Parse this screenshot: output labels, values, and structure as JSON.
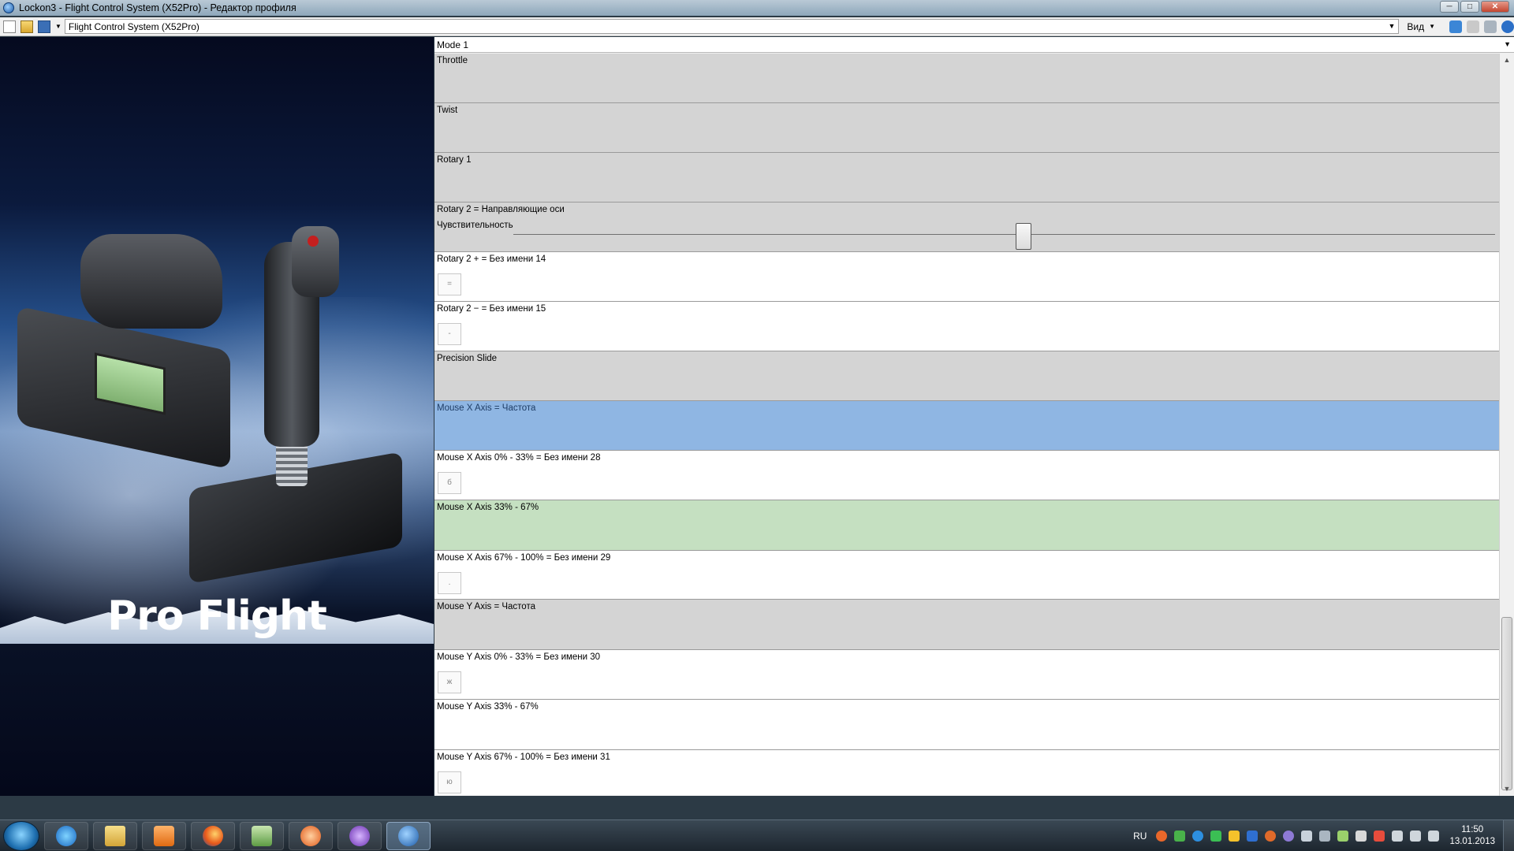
{
  "window": {
    "title": "Lockon3 - Flight Control System (X52Pro) - Редактор профиля",
    "minimize_glyph": "─",
    "maximize_glyph": "□",
    "close_glyph": "✕"
  },
  "toolbar": {
    "profile_value": "Flight Control System (X52Pro)",
    "view_label": "Вид",
    "dropdown_glyph": "▼"
  },
  "left_panel": {
    "brand": "Pro Flight"
  },
  "config": {
    "mode": "Mode 1",
    "rows": [
      {
        "label": "Throttle"
      },
      {
        "label": "Twist"
      },
      {
        "label": "Rotary 1"
      },
      {
        "label": "Rotary 2 = Направляющие оси",
        "sensitivity_label": "Чувствительность",
        "sensitivity_value": 0.52
      },
      {
        "label": "Rotary 2  +  = Без имени 14",
        "key": "="
      },
      {
        "label": "Rotary 2  −  = Без имени 15",
        "key": "-"
      },
      {
        "label": "Precision Slide"
      },
      {
        "label": "Mouse X Axis = Частота"
      },
      {
        "label": "Mouse X Axis 0% - 33% = Без имени 28",
        "key": "б"
      },
      {
        "label": "Mouse X Axis 33% - 67%"
      },
      {
        "label": "Mouse X Axis 67% - 100% = Без имени 29",
        "key": "."
      },
      {
        "label": "Mouse Y Axis = Частота"
      },
      {
        "label": "Mouse Y Axis 0% - 33% = Без имени 30",
        "key": "ж"
      },
      {
        "label": "Mouse Y Axis 33% - 67%"
      },
      {
        "label": "Mouse Y Axis 67% - 100% = Без имени 31",
        "key": "ю"
      }
    ]
  },
  "taskbar": {
    "language": "RU",
    "time": "11:50",
    "date": "13.01.2013"
  },
  "colors": {
    "row_gray": "#d4d4d4",
    "row_white": "#ffffff",
    "row_selected_blue": "#8fb6e3",
    "row_green": "#c5e0c1"
  },
  "icons": [
    "new-file-icon",
    "open-folder-icon",
    "save-icon",
    "ie-icon",
    "explorer-icon",
    "media-player-icon",
    "firefox-icon",
    "green-app-icon",
    "orange-app-icon",
    "purple-app-icon",
    "blue-app-icon"
  ]
}
